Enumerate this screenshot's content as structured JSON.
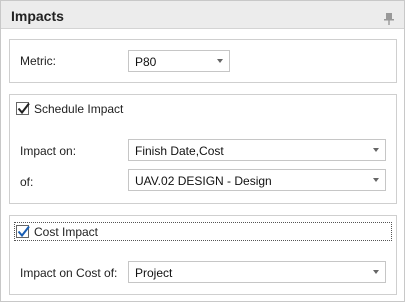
{
  "panel": {
    "title": "Impacts",
    "pin_icon": "pin-icon"
  },
  "metric": {
    "label": "Metric:",
    "value": "P80"
  },
  "schedule_impact": {
    "label": "Schedule Impact",
    "checked": true,
    "impact_on_label": "Impact on:",
    "impact_on_value": "Finish Date,Cost",
    "of_label": "of:",
    "of_value": "UAV.02 DESIGN - Design"
  },
  "cost_impact": {
    "label": "Cost Impact",
    "checked": true,
    "impact_on_cost_label": "Impact on Cost of:",
    "impact_on_cost_value": "Project"
  }
}
